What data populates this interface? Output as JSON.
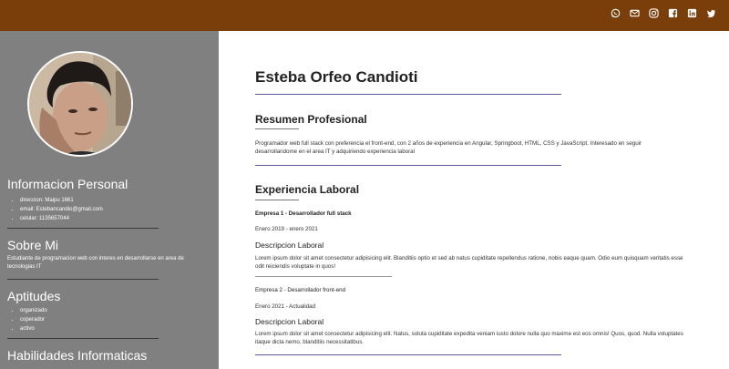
{
  "header": {
    "social_icons": [
      "whatsapp-icon",
      "email-icon",
      "instagram-icon",
      "facebook-icon",
      "linkedin-icon",
      "twitter-icon"
    ],
    "background": "#7a3e0a"
  },
  "sidebar": {
    "background": "#808080",
    "personal": {
      "title": "Informacion Personal",
      "items": [
        "direccion: Maipu 1661",
        "email: Estebancandio@gmail.com",
        "celular: 1135657044"
      ]
    },
    "about": {
      "title": "Sobre Mi",
      "text": "Estudiante de programacion web con interes en desarrollarse en area de tecnologias IT"
    },
    "skills": {
      "title": "Aptitudes",
      "items": [
        "organizado",
        "coperador",
        "activo"
      ]
    },
    "tech": {
      "title": "Habilidades Informaticas"
    }
  },
  "main": {
    "name": "Esteba Orfeo Candioti",
    "summary": {
      "title": "Resumen Profesional",
      "text": "Programador web full stack con preferencia el front-end, con 2 años de experiencia en Angular, Springboot, HTML, CSS y JavaScript. Interesado en seguir desarrollandome en el area IT y adquiriendo experiencia laboral"
    },
    "experience": {
      "title": "Experiencia Laboral",
      "jobs": [
        {
          "title": "Empresa 1 - Desarrollador full stack",
          "dates": "Enero 2019 - enero 2021",
          "desc_title": "Descripcion Laboral",
          "desc": "Lorem ipsum dolor sit amet consectetur adipisicing elit. Blanditiis optio et sed ab natus cupiditate repellendus ratione, nobis eaque quam. Odio eum quisquam veritatis esse odit reiciendis voluptate in quos!"
        },
        {
          "title": "Empresa 2 - Desarrollador front-end",
          "dates": "Enero 2021 - Actualidad",
          "desc_title": "Descripcion Laboral",
          "desc": "Lorem ipsum dolor sit amet consectetur adipisicing elit. Natus, soluta cupiditate expedita veniam iusto dolore nulla quo maxime est eos omnis! Quos, quod. Nulla voluptates itaque dicta nemo, blanditiis necessitatibus."
        }
      ]
    }
  }
}
